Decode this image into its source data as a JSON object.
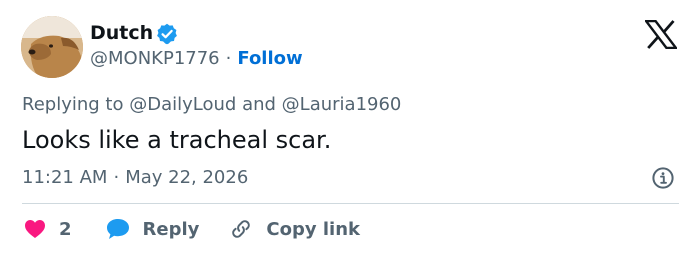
{
  "author": {
    "name": "Dutch",
    "handle": "@MONKP1776",
    "separator": "·",
    "follow_label": "Follow",
    "verified_icon": "verified-badge-icon",
    "verified_color": "#1d9bf0"
  },
  "reply_context": {
    "prefix": "Replying to",
    "mention_1": "@DailyLoud",
    "conjunction": "and",
    "mention_2": "@Lauria1960"
  },
  "tweet": {
    "text": "Looks like a tracheal scar.",
    "time": "11:21 AM",
    "separator": "·",
    "date": "May 22, 2026"
  },
  "actions": {
    "like_count": "2",
    "like_color": "#f91880",
    "reply_label": "Reply",
    "reply_color": "#1d9bf0",
    "copy_label": "Copy link"
  },
  "icons": {
    "brand": "x-logo-icon",
    "info": "info-icon",
    "like": "heart-icon",
    "reply": "reply-bubble-icon",
    "copy": "link-icon"
  },
  "colors": {
    "text_primary": "#0f1419",
    "text_secondary": "#536471",
    "link": "#006fd6",
    "divider": "#cfd9de"
  }
}
